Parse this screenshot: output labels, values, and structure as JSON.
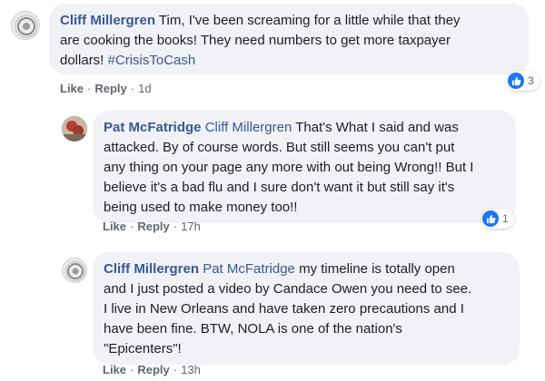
{
  "comments": [
    {
      "author": "Cliff Millergren",
      "line1_rest": "Tim, I've been screaming for a little while that they",
      "line2": "are cooking the books! They need numbers to get more taxpayer",
      "line3_pre": "dollars!",
      "hashtag": "#CrisisToCash",
      "like_label": "Like",
      "reply_label": "Reply",
      "time": "1d",
      "reaction_count": "3"
    },
    {
      "author": "Pat McFatridge",
      "mention": "Cliff Millergren",
      "line1_rest": "That's What I said and was",
      "line2": "attacked. By of course words. But still seems you can't put",
      "line3": "any thing on your page any more with out being Wrong!! But I",
      "line4": "believe it's a bad flu and I sure don't want it but still say it's",
      "line5": "being used to make money too!!",
      "like_label": "Like",
      "reply_label": "Reply",
      "time": "17h",
      "reaction_count": "1"
    },
    {
      "author": "Cliff Millergren",
      "mention": "Pat McFatridge",
      "line1_rest": "my timeline is totally open",
      "line2": "and I just posted a video by Candace Owen you need to see.",
      "line3": "I live in New Orleans and have taken zero precautions and I",
      "line4": "have been fine. BTW, NOLA is one of the nation's",
      "line5": "\"Epicenters\"!",
      "like_label": "Like",
      "reply_label": "Reply",
      "time": "13h"
    }
  ],
  "colors": {
    "link": "#385898",
    "bubble": "#f0f2f5",
    "like_blue": "#1877f2"
  }
}
